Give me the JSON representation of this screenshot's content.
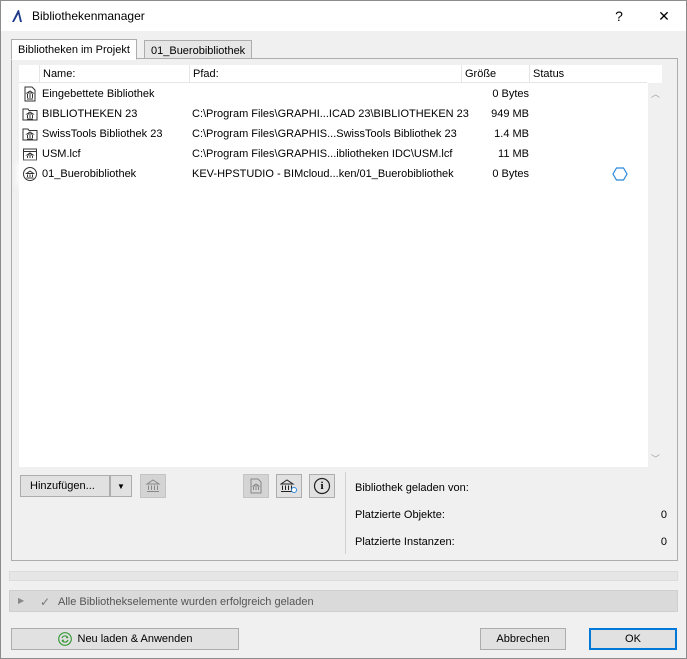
{
  "window": {
    "title": "Bibliothekenmanager",
    "help_label": "?",
    "close_label": "✕"
  },
  "tabs": [
    {
      "label": "Bibliotheken im Projekt",
      "active": true
    },
    {
      "label": "01_Buerobibliothek",
      "active": false
    }
  ],
  "table": {
    "headers": {
      "name": "Name:",
      "path": "Pfad:",
      "size": "Größe",
      "status": "Status"
    },
    "rows": [
      {
        "icon": "embedded-library-icon",
        "name": "Eingebettete Bibliothek",
        "path": "",
        "size": "0 Bytes"
      },
      {
        "icon": "folder-library-icon",
        "name": "BIBLIOTHEKEN 23",
        "path": "C:\\Program Files\\GRAPHI...ICAD 23\\BIBLIOTHEKEN 23",
        "size": "949 MB"
      },
      {
        "icon": "folder-library-icon",
        "name": "SwissTools Bibliothek 23",
        "path": "C:\\Program Files\\GRAPHIS...SwissTools Bibliothek 23",
        "size": "1.4 MB"
      },
      {
        "icon": "container-library-icon",
        "name": "USM.lcf",
        "path": "C:\\Program Files\\GRAPHIS...ibliotheken IDC\\USM.lcf",
        "size": "11 MB"
      },
      {
        "icon": "bimcloud-library-icon",
        "name": "01_Buerobibliothek",
        "path": "KEV-HPSTUDIO - BIMcloud...ken/01_Buerobibliothek",
        "size": "0 Bytes",
        "status_icon": "hexagon-status-icon",
        "selected": true
      }
    ]
  },
  "toolbar": {
    "add_label": "Hinzufügen...",
    "add_arrow": "▼",
    "info_glyph": "i"
  },
  "info": {
    "loaded_from_label": "Bibliothek geladen von:",
    "placed_objects_label": "Platzierte Objekte:",
    "placed_objects_value": "0",
    "placed_instances_label": "Platzierte Instanzen:",
    "placed_instances_value": "0"
  },
  "statusbar": {
    "message": "Alle Bibliothekselemente wurden erfolgreich geladen"
  },
  "footer": {
    "reload_label": "Neu laden & Anwenden",
    "cancel_label": "Abbrechen",
    "ok_label": "OK"
  },
  "colors": {
    "accent": "#0078d7",
    "reload_icon": "#3a9a3a",
    "status_icon": "#2b88d8"
  }
}
